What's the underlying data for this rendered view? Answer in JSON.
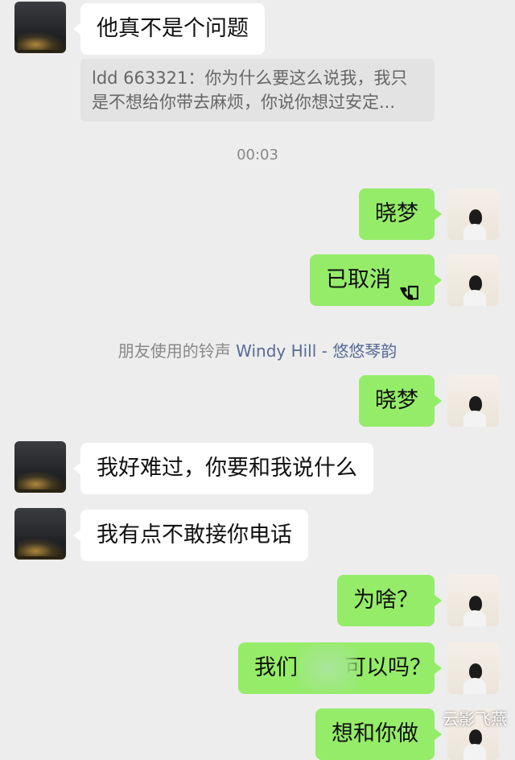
{
  "messages": [
    {
      "text": "他真不是个问题"
    },
    {
      "text": "晓梦"
    },
    {
      "text": "已取消"
    },
    {
      "text": "晓梦"
    },
    {
      "text": "我好难过，你要和我说什么"
    },
    {
      "text": "我有点不敢接你电话"
    },
    {
      "text": "为啥？"
    },
    {
      "text_left": "我们",
      "text_right": "可以吗？"
    },
    {
      "text": "想和你做"
    }
  ],
  "quote": {
    "line1": "ldd 663321：你为什么要这么说我，我只",
    "line2": "是不想给你带去麻烦，你说你想过安定..."
  },
  "timestamp": "00:03",
  "ringtone_notice": {
    "prefix": "朋友使用的铃声",
    "song": "Windy Hill - 悠悠琴韵"
  },
  "watermark": "云影飞燕",
  "icons": {
    "call": "voice-call-icon"
  },
  "colors": {
    "background": "#ededed",
    "incoming_bubble": "#ffffff",
    "outgoing_bubble": "#95ec69",
    "link": "#576b95"
  }
}
